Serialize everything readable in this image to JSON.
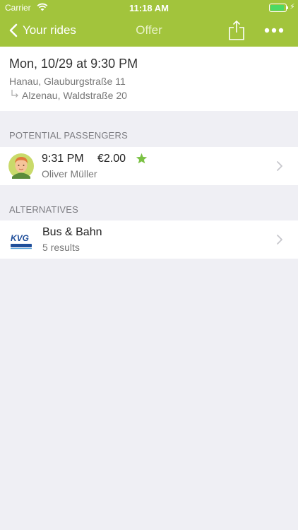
{
  "status_bar": {
    "carrier": "Carrier",
    "time": "11:18 AM",
    "battery_level": 0.9
  },
  "nav": {
    "back_label": "Your rides",
    "title": "Offer"
  },
  "ride": {
    "datetime": "Mon, 10/29 at 9:30 PM",
    "from": "Hanau, Glauburgstraße 11",
    "to": "Alzenau, Waldstraße 20"
  },
  "passengers_section": {
    "title": "POTENTIAL PASSENGERS",
    "items": [
      {
        "time": "9:31 PM",
        "price": "€2.00",
        "name": "Oliver Müller",
        "favorite": true
      }
    ]
  },
  "alternatives_section": {
    "title": "ALTERNATIVES",
    "items": [
      {
        "logo_text": "KVG",
        "title": "Bus & Bahn",
        "subtitle": "5 results"
      }
    ]
  },
  "colors": {
    "accent": "#a2c43c",
    "background": "#efeff4",
    "star": "#7ac143",
    "battery": "#4cd964"
  }
}
